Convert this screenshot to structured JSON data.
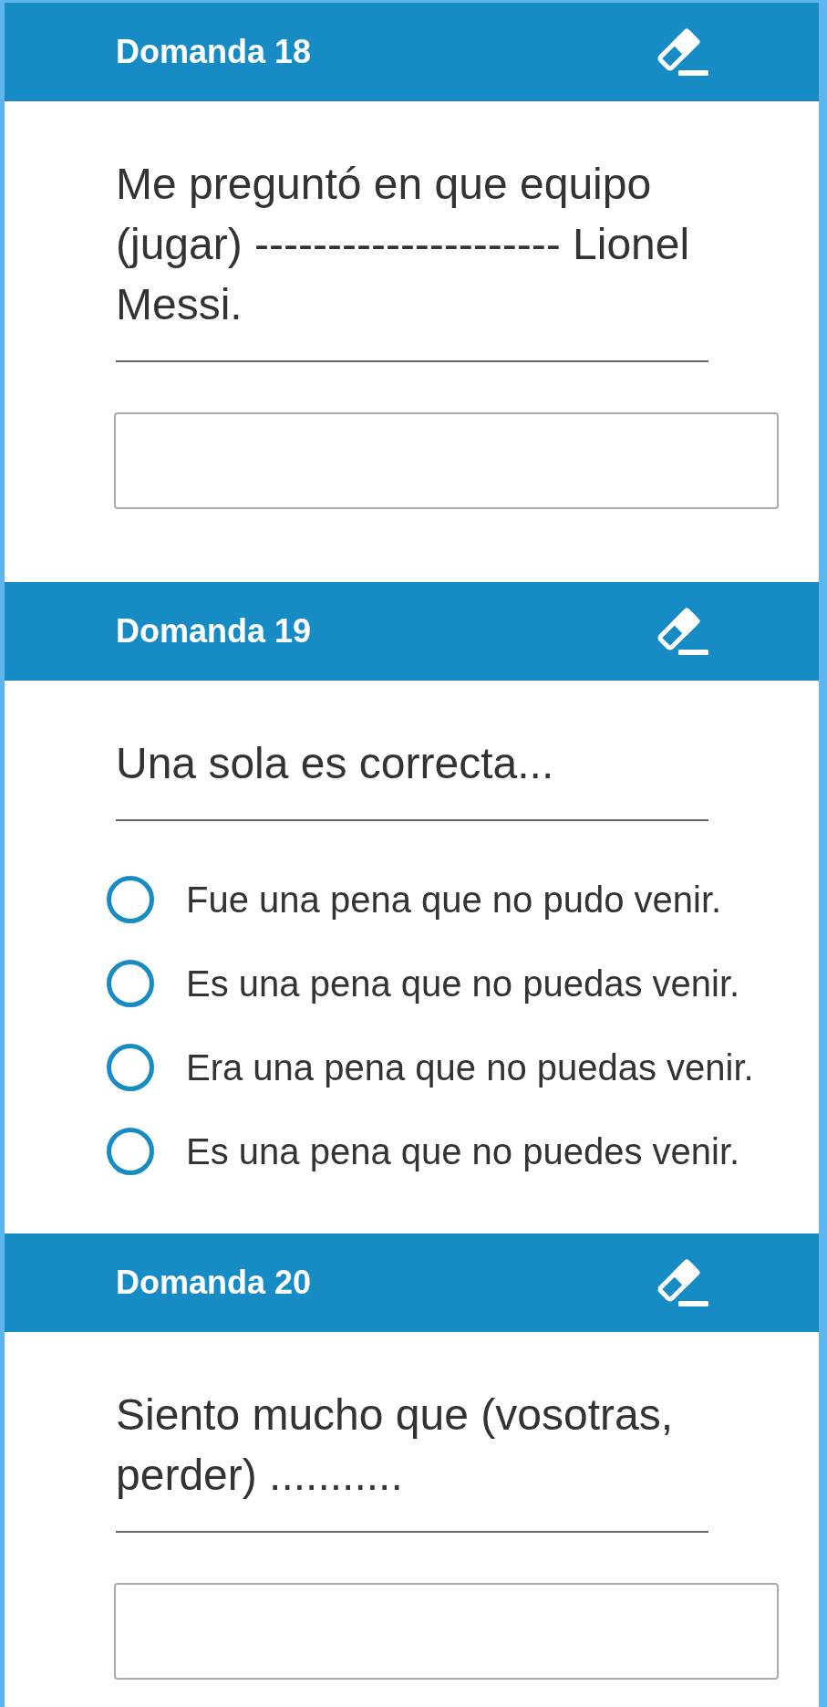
{
  "questions": [
    {
      "kind": "text",
      "title": "Domanda 18",
      "text": "Me preguntó en que equipo (jugar) --------------------- Lionel Messi."
    },
    {
      "kind": "choice",
      "title": "Domanda 19",
      "text": "Una sola es correcta...",
      "options": [
        {
          "label": "Fue una pena que no pudo venir.",
          "selected": false
        },
        {
          "label": "Es una pena que no puedas venir.",
          "selected": false
        },
        {
          "label": "Era una pena que no puedas venir.",
          "selected": false
        },
        {
          "label": "Es una pena que no puedes venir.",
          "selected": false
        }
      ]
    },
    {
      "kind": "text",
      "title": "Domanda 20",
      "text": "Siento mucho que (vosotras, perder) ..........."
    }
  ]
}
